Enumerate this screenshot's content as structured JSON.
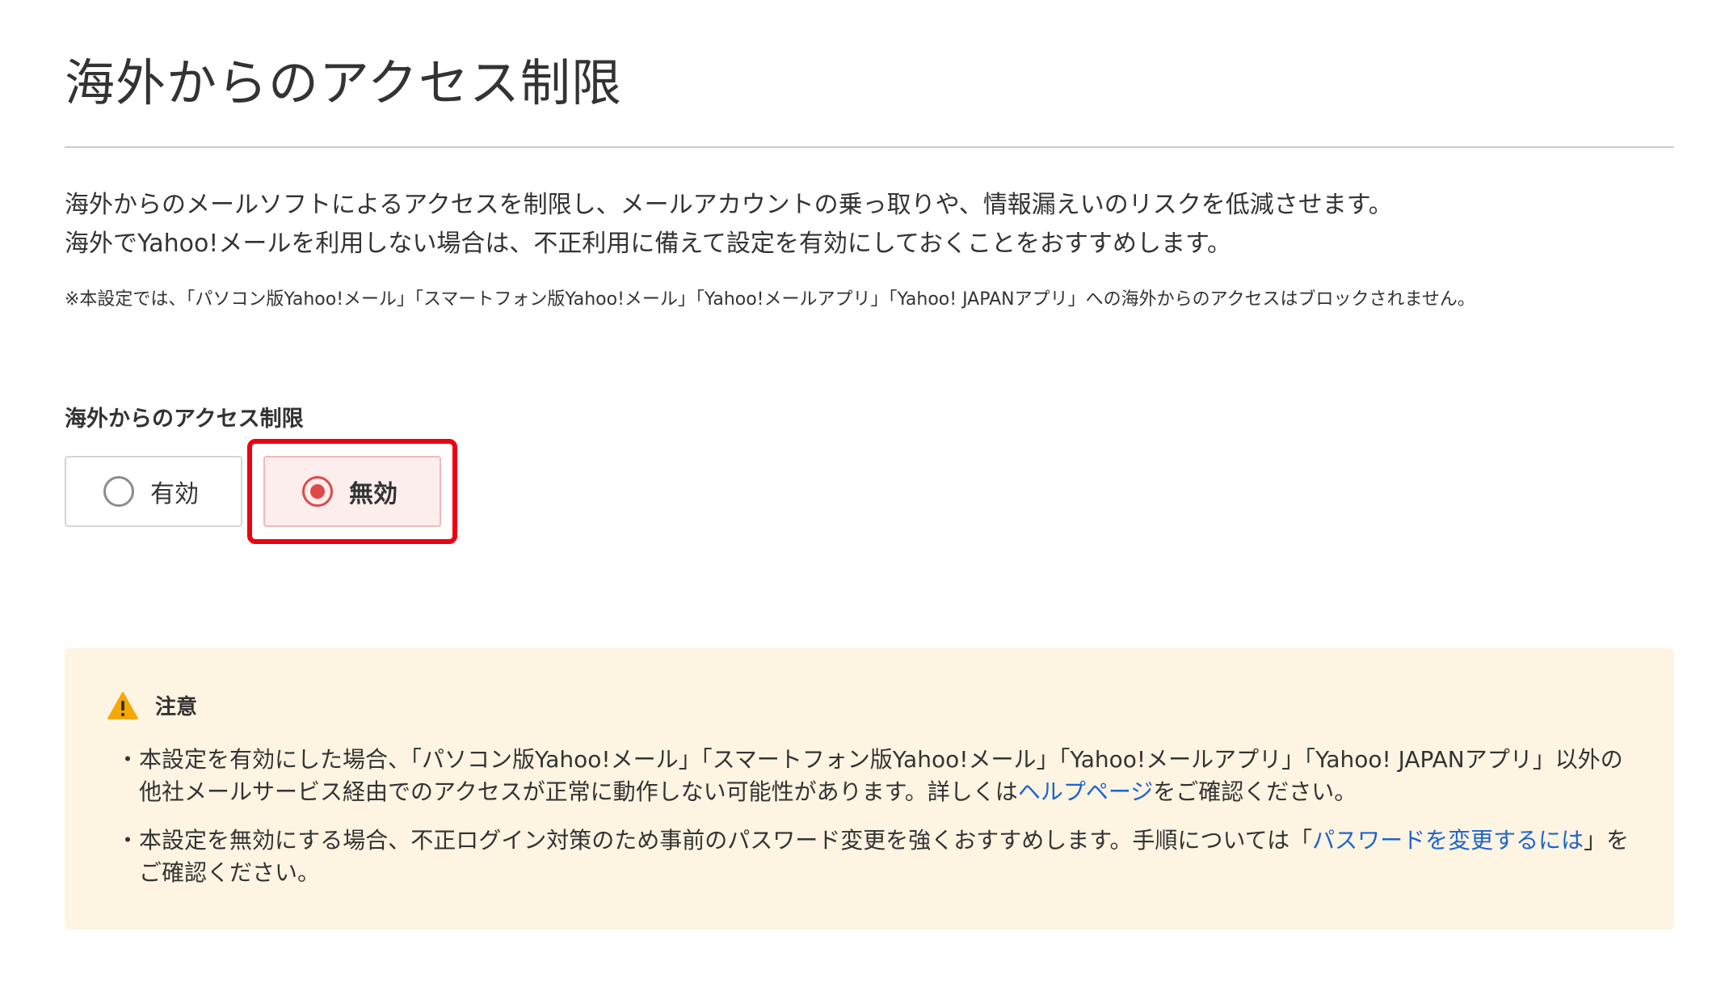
{
  "page": {
    "title": "海外からのアクセス制限",
    "description_line1": "海外からのメールソフトによるアクセスを制限し、メールアカウントの乗っ取りや、情報漏えいのリスクを低減させます。",
    "description_line2": "海外でYahoo!メールを利用しない場合は、不正利用に備えて設定を有効にしておくことをおすすめします。",
    "note": "※本設定では、「パソコン版Yahoo!メール」「スマートフォン版Yahoo!メール」「Yahoo!メールアプリ」「Yahoo! JAPANアプリ」への海外からのアクセスはブロックされません。"
  },
  "setting": {
    "label": "海外からのアクセス制限",
    "options": [
      {
        "label": "有効",
        "selected": false
      },
      {
        "label": "無効",
        "selected": true
      }
    ]
  },
  "caution": {
    "title": "注意",
    "icon": "warning-icon",
    "items": [
      {
        "bullet": "・",
        "text_before": "本設定を有効にした場合、「パソコン版Yahoo!メール」「スマートフォン版Yahoo!メール」「Yahoo!メールアプリ」「Yahoo! JAPANアプリ」以外の他社メールサービス経由でのアクセスが正常に動作しない可能性があります。詳しくは",
        "link_text": "ヘルプページ",
        "text_after": "をご確認ください。"
      },
      {
        "bullet": "・",
        "text_before": "本設定を無効にする場合、不正ログイン対策のため事前のパスワード変更を強くおすすめします。手順については「",
        "link_text": "パスワードを変更するには",
        "text_after": "」をご確認ください。"
      }
    ]
  },
  "colors": {
    "accent_red": "#e04848",
    "highlight_red": "#ee0011",
    "link_blue": "#1e64cc",
    "caution_bg": "#fef4e2",
    "warning_yellow": "#f5a800"
  }
}
